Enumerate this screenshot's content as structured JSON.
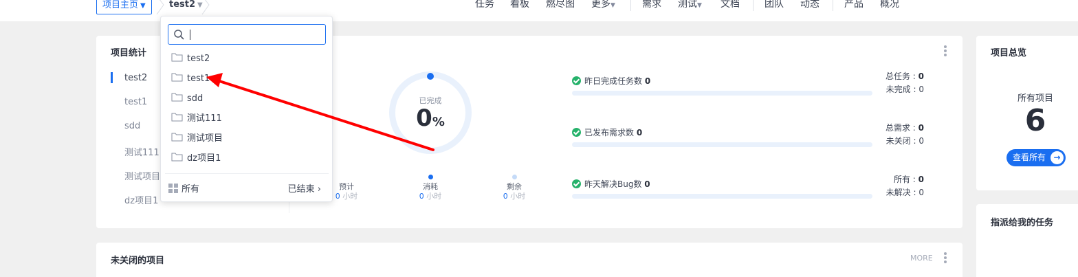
{
  "breadcrumb": {
    "home_label": "项目主页",
    "current_project": "test2"
  },
  "nav": {
    "items": [
      "任务",
      "看板",
      "燃尽图",
      "更多",
      "需求",
      "测试",
      "文档",
      "团队",
      "动态",
      "产品",
      "概况"
    ]
  },
  "stats_card": {
    "title": "项目统计",
    "projects": [
      "test2",
      "test1",
      "sdd",
      "测试111",
      "测试项目",
      "dz项目1"
    ],
    "ring": {
      "label": "已完成",
      "value": "0",
      "unit": "%"
    },
    "hours": [
      {
        "label": "预计",
        "value": "0",
        "unit": "小时",
        "dot_color": "#ffffff"
      },
      {
        "label": "消耗",
        "value": "0",
        "unit": "小时",
        "dot_color": "#1a6ef0"
      },
      {
        "label": "剩余",
        "value": "0",
        "unit": "小时",
        "dot_color": "#c5dbf8"
      }
    ],
    "rows": [
      {
        "label": "昨日完成任务数",
        "value": "0",
        "side": [
          {
            "k": "总任务",
            "v": "0"
          },
          {
            "k": "未完成",
            "v": "0"
          }
        ]
      },
      {
        "label": "已发布需求数",
        "value": "0",
        "side": [
          {
            "k": "总需求",
            "v": "0"
          },
          {
            "k": "未关闭",
            "v": "0"
          }
        ]
      },
      {
        "label": "昨天解决Bug数",
        "value": "0",
        "side": [
          {
            "k": "所有",
            "v": "0"
          },
          {
            "k": "未解决",
            "v": "0"
          }
        ]
      }
    ]
  },
  "overview_card": {
    "title": "项目总览",
    "label": "所有项目",
    "count": "6",
    "button": "查看所有"
  },
  "tasks_card": {
    "title": "指派给我的任务"
  },
  "open_projects_card": {
    "title": "未关闭的项目",
    "more": "MORE"
  },
  "dropdown": {
    "search_value": "",
    "items": [
      "test2",
      "test1",
      "sdd",
      "测试111",
      "测试项目",
      "dz项目1"
    ],
    "all_label": "所有",
    "closed_label": "已结束"
  },
  "colors": {
    "accent": "#1a6ef0",
    "success": "#26b26b",
    "annotation_arrow": "#ff0000"
  }
}
